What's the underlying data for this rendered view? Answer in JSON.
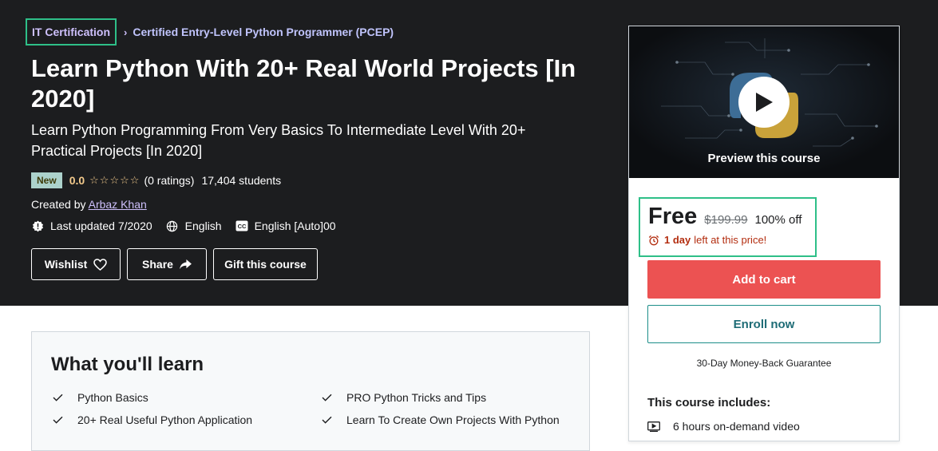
{
  "breadcrumb": {
    "items": [
      "IT Certification",
      "Certified Entry-Level Python Programmer (PCEP)"
    ],
    "separator": "›"
  },
  "course": {
    "title": "Learn Python With 20+ Real World Projects [In 2020]",
    "subtitle": "Learn Python Programming From Very Basics To Intermediate Level With 20+ Practical Projects [In 2020]",
    "badge": "New",
    "rating": "0.0",
    "stars": "☆☆☆☆☆",
    "ratings_count": "(0 ratings)",
    "students": "17,404 students",
    "created_prefix": "Created by",
    "author": "Arbaz Khan",
    "last_updated": "Last updated 7/2020",
    "language": "English",
    "captions": "English [Auto]00"
  },
  "actions": {
    "wishlist": "Wishlist",
    "share": "Share",
    "gift": "Gift this course"
  },
  "sidebar": {
    "preview_label": "Preview this course",
    "price": "Free",
    "original_price": "$199.99",
    "discount": "100% off",
    "timer_bold": "1 day",
    "timer_rest": "left at this price!",
    "add_to_cart": "Add to cart",
    "enroll": "Enroll now",
    "guarantee": "30-Day Money-Back Guarantee",
    "includes_title": "This course includes:",
    "includes": [
      "6 hours on-demand video"
    ]
  },
  "learn": {
    "title": "What you'll learn",
    "items": [
      "Python Basics",
      "PRO Python Tricks and Tips",
      "20+ Real Useful Python Application",
      "Learn To Create Own Projects With Python"
    ]
  },
  "colors": {
    "hero_bg": "#1c1d1f",
    "accent_purple": "#cec0fc",
    "highlight_green": "#2ebf88",
    "cart_red": "#ec5252",
    "rating_gold": "#f3ca8c"
  }
}
